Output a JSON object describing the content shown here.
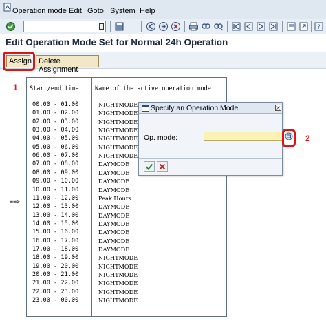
{
  "menu": {
    "items": [
      "Operation mode",
      "Edit",
      "Goto",
      "System",
      "Help"
    ]
  },
  "toolbar": {
    "command_field_value": "",
    "icons": [
      "enter-icon",
      "save-icon",
      "back-icon",
      "exit-icon",
      "cancel-icon",
      "print-icon",
      "find-icon",
      "find-next-icon",
      "first-page-icon",
      "prev-page-icon",
      "next-page-icon",
      "last-page-icon",
      "new-session-icon",
      "shortcut-icon",
      "help-icon",
      "layout-icon"
    ]
  },
  "page": {
    "title": "Edit Operation Mode Set for Normal 24h Operation"
  },
  "app_toolbar": {
    "assign_label": "Assign",
    "delete_label": "Delete Assignment"
  },
  "annotations": {
    "step1": "1",
    "step2": "2"
  },
  "table": {
    "header_time": "Start/end time",
    "header_mode": "Name of the active operation mode",
    "current_marker": "==>",
    "current_row_index": 11,
    "rows": [
      {
        "time": "00.00 - 01.00",
        "mode": "NIGHTMODE"
      },
      {
        "time": "01.00 - 02.00",
        "mode": "NIGHTMODE"
      },
      {
        "time": "02.00 - 03.00",
        "mode": "NIGHTMODE"
      },
      {
        "time": "03.00 - 04.00",
        "mode": "NIGHTMODE"
      },
      {
        "time": "04.00 - 05.00",
        "mode": "NIGHTMODE"
      },
      {
        "time": "05.00 - 06.00",
        "mode": "NIGHTMODE"
      },
      {
        "time": "06.00 - 07.00",
        "mode": "NIGHTMODE"
      },
      {
        "time": "07.00 - 08.00",
        "mode": "DAYMODE"
      },
      {
        "time": "08.00 - 09.00",
        "mode": "DAYMODE"
      },
      {
        "time": "09.00 - 10.00",
        "mode": "DAYMODE"
      },
      {
        "time": "10.00 - 11.00",
        "mode": "DAYMODE"
      },
      {
        "time": "11.00 - 12.00",
        "mode": "Peak Hours"
      },
      {
        "time": "12.00 - 13.00",
        "mode": "DAYMODE"
      },
      {
        "time": "13.00 - 14.00",
        "mode": "DAYMODE"
      },
      {
        "time": "14.00 - 15.00",
        "mode": "DAYMODE"
      },
      {
        "time": "15.00 - 16.00",
        "mode": "DAYMODE"
      },
      {
        "time": "16.00 - 17.00",
        "mode": "DAYMODE"
      },
      {
        "time": "17.00 - 18.00",
        "mode": "DAYMODE"
      },
      {
        "time": "18.00 - 19.00",
        "mode": "NIGHTMODE"
      },
      {
        "time": "19.00 - 20.00",
        "mode": "NIGHTMODE"
      },
      {
        "time": "20.00 - 21.00",
        "mode": "NIGHTMODE"
      },
      {
        "time": "21.00 - 22.00",
        "mode": "NIGHTMODE"
      },
      {
        "time": "22.00 - 23.00",
        "mode": "NIGHTMODE"
      },
      {
        "time": "23.00 - 00.00",
        "mode": "NIGHTMODE"
      }
    ]
  },
  "dialog": {
    "title": "Specify an Operation Mode",
    "field_label": "Op. mode:",
    "field_value": "",
    "close_symbol": "×"
  },
  "colors": {
    "highlight": "#e01414",
    "input_yellow": "#fdf2b5",
    "button_bg": "#f2e8c6"
  }
}
